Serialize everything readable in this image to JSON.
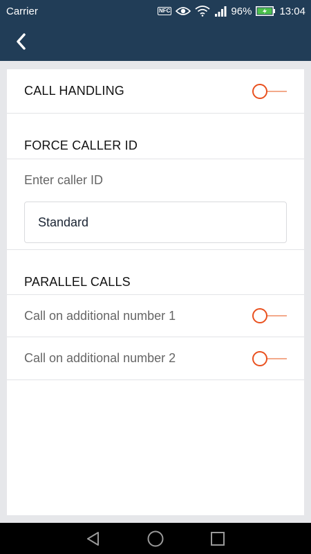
{
  "status_bar": {
    "carrier": "Carrier",
    "nfc": "NFC",
    "battery": "96%",
    "time": "13:04"
  },
  "colors": {
    "header": "#213d57",
    "accent": "#e9501e",
    "background": "#e6e7ea"
  },
  "sections": {
    "call_handling": {
      "title": "CALL HANDLING",
      "enabled": false
    },
    "force_caller_id": {
      "title": "FORCE CALLER ID",
      "field_label": "Enter caller ID",
      "field_value": "Standard"
    },
    "parallel_calls": {
      "title": "PARALLEL CALLS",
      "items": [
        {
          "label": "Call on additional number 1",
          "enabled": false
        },
        {
          "label": "Call on additional number 2",
          "enabled": false
        }
      ]
    }
  },
  "nav": {
    "back_icon": "triangle-left",
    "home_icon": "circle",
    "recents_icon": "square"
  }
}
